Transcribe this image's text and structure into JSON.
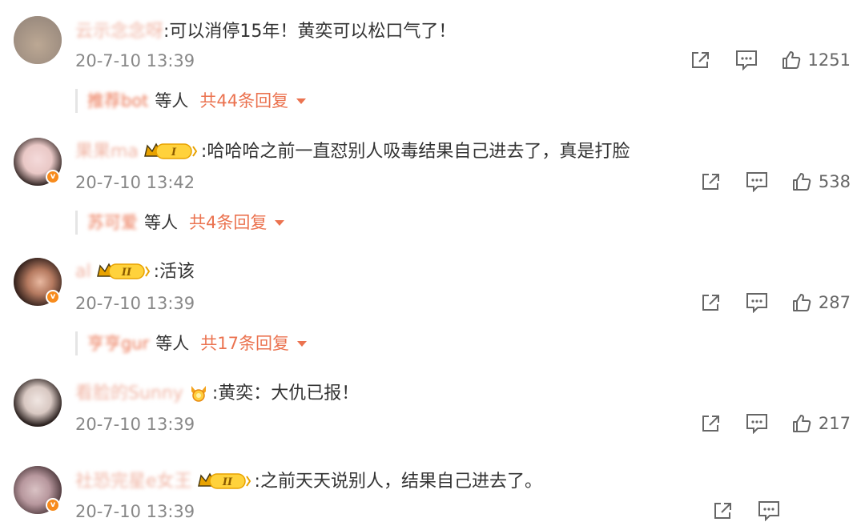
{
  "comments": [
    {
      "username": "云示念念呀",
      "text": ":可以消停15年！黄奕可以松口气了！",
      "time": "20-7-10 13:39",
      "likes": "1251",
      "replies": {
        "who": "推荐bot",
        "etc": "等人",
        "count": "共44条回复"
      }
    },
    {
      "username": "果果ma",
      "text": ":哈哈哈之前一直怼别人吸毒结果自己进去了，真是打脸",
      "time": "20-7-10 13:42",
      "likes": "538",
      "badge_level": "I",
      "replies": {
        "who": "苏可爱",
        "etc": "等人",
        "count": "共4条回复"
      }
    },
    {
      "username": "al",
      "text": ":活该",
      "time": "20-7-10 13:39",
      "likes": "287",
      "badge_level": "II",
      "replies": {
        "who": "亨亨gur",
        "etc": "等人",
        "count": "共17条回复"
      }
    },
    {
      "username": "看脸的Sunny",
      "text": ":黄奕：大仇已报！",
      "time": "20-7-10 13:39",
      "likes": "217"
    },
    {
      "username": "社恐完星e女王",
      "text": ":之前天天说别人，结果自己进去了。",
      "time": "20-7-10 13:39",
      "badge_level": "II"
    }
  ],
  "icons": {
    "share": "share-icon",
    "comment": "comment-icon",
    "like": "thumbs-up-icon",
    "expand": "chevron-down-icon"
  },
  "colors": {
    "username": "#eb7350",
    "timestamp": "#888888",
    "badge": "#f78b1d",
    "crown": "#e8a200"
  }
}
